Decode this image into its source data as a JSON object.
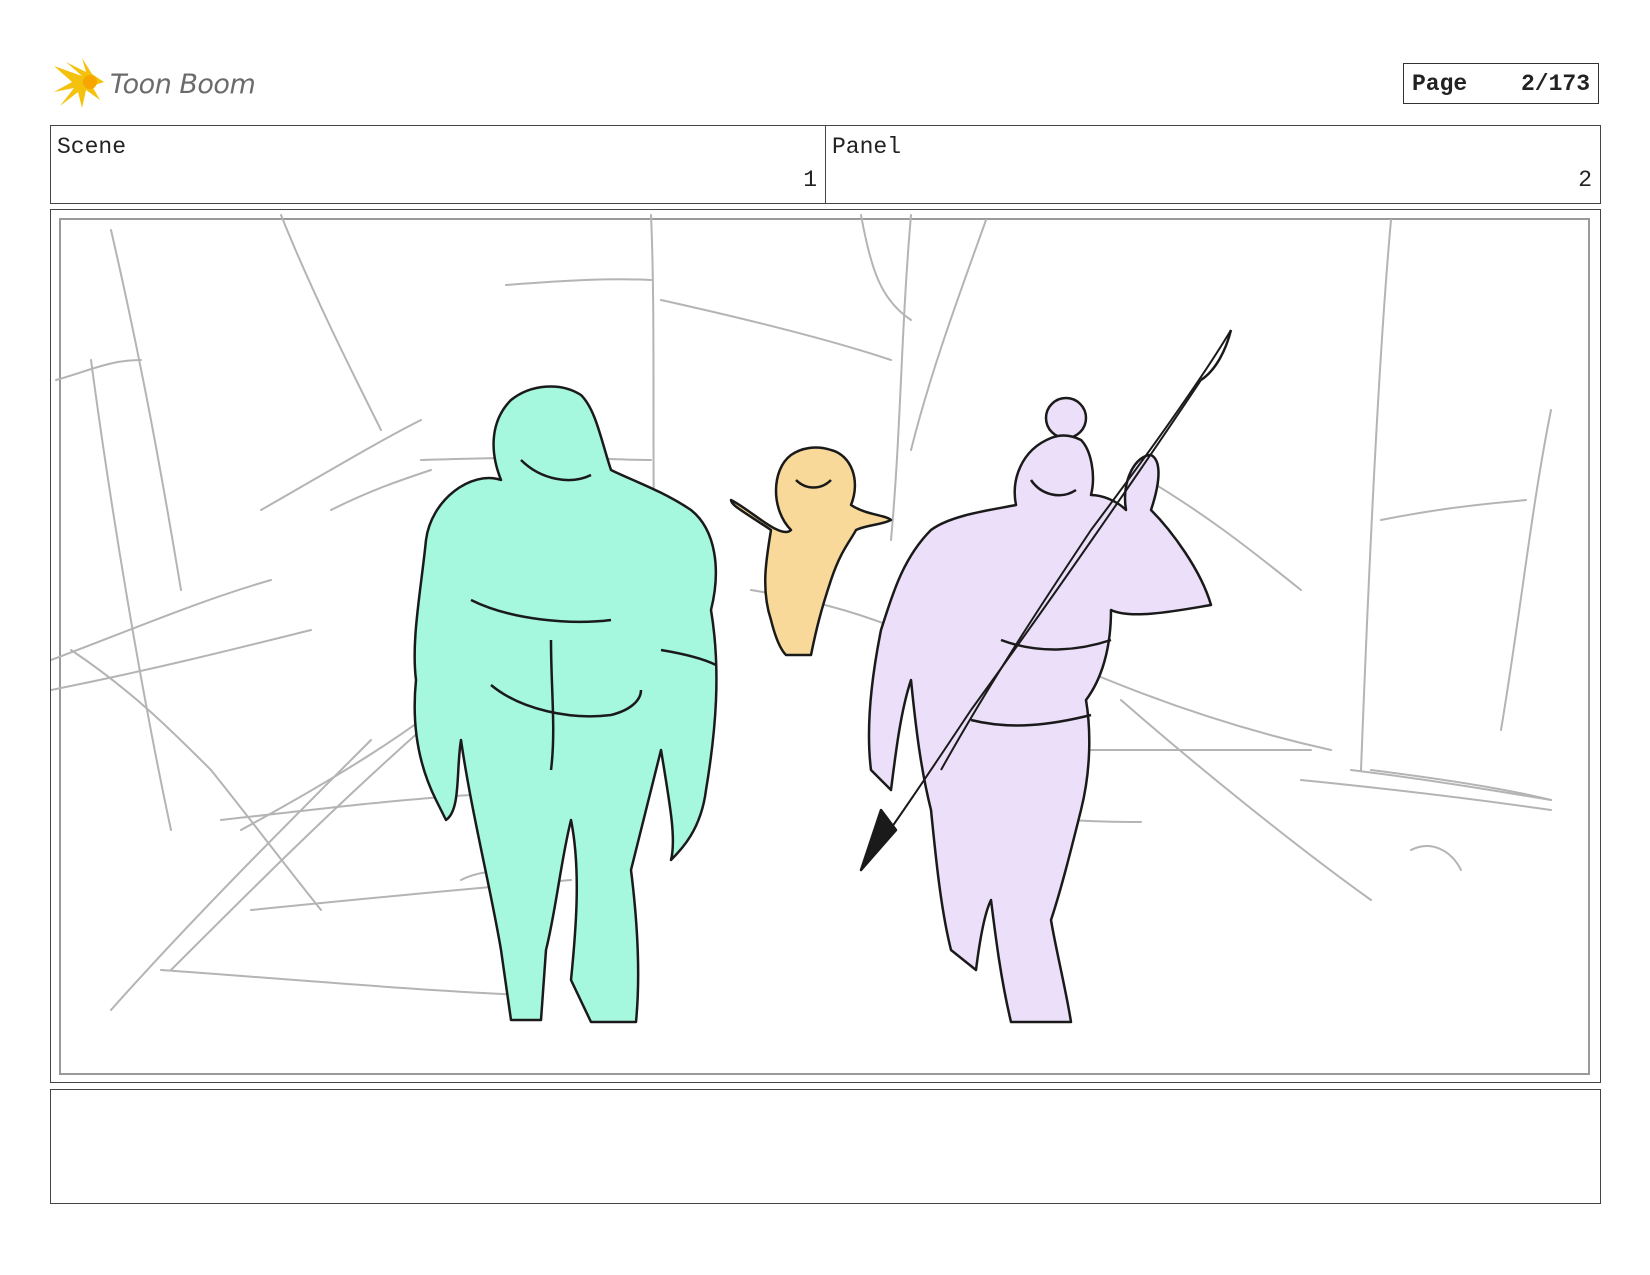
{
  "logo": {
    "text": "Toon Boom",
    "icon": "toon-boom-burst-icon",
    "accent": "#f4c20d"
  },
  "page": {
    "label": "Page",
    "value": "2/173"
  },
  "header": {
    "scene": {
      "label": "Scene",
      "value": "1"
    },
    "panel": {
      "label": "Panel",
      "value": "2"
    }
  },
  "drawing": {
    "characters": [
      {
        "name": "large-green-warrior",
        "color": "#a5f7dd"
      },
      {
        "name": "small-yellow-child",
        "color": "#f8d99a"
      },
      {
        "name": "purple-elf-archer",
        "color": "#ecdff9"
      }
    ],
    "sketch_color": "#b4b4b4",
    "ink_color": "#1a1a1a"
  },
  "notes": {
    "text": ""
  }
}
